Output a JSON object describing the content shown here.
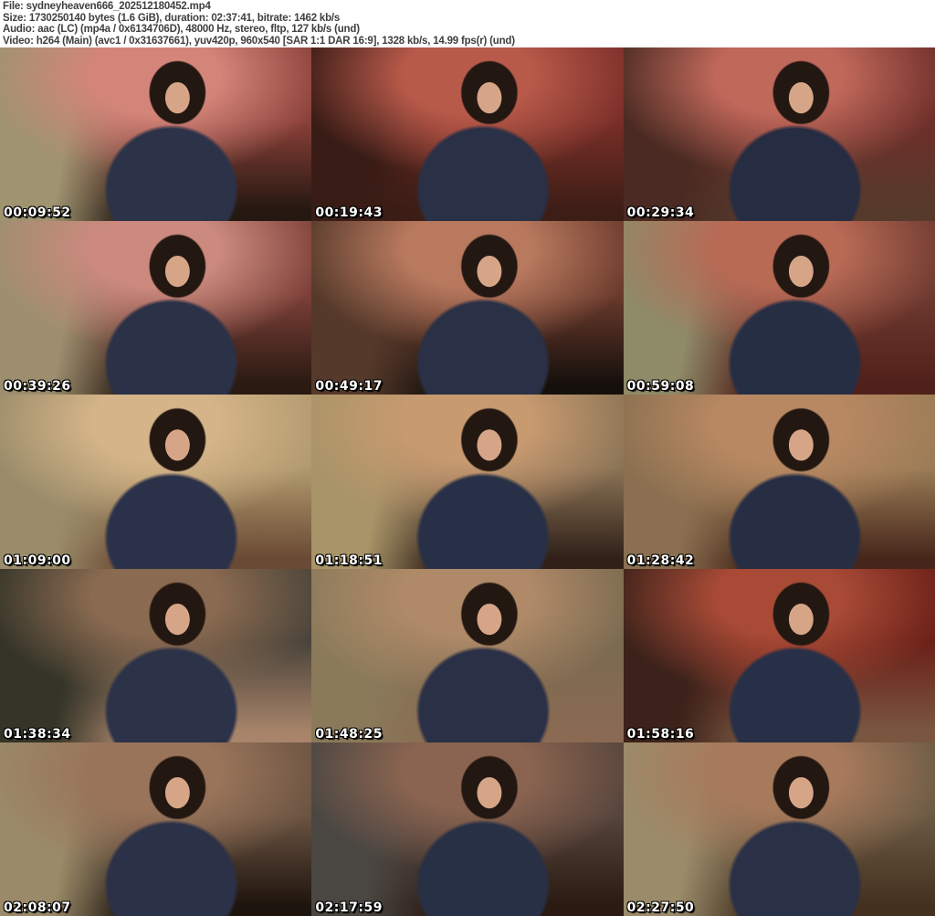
{
  "header": {
    "file_line": "File: sydneyheaven666_202512180452.mp4",
    "size_line": "Size: 1730250140 bytes (1.6 GiB), duration: 02:37:41, bitrate: 1462 kb/s",
    "audio_line": "Audio: aac (LC) (mp4a / 0x6134706D), 48000 Hz, stereo, fltp, 127 kb/s (und)",
    "video_line": "Video: h264 (Main) (avc1 / 0x31637661), yuv420p, 960x540 [SAR 1:1 DAR 16:9], 1328 kb/s, 14.99 fps(r) (und)"
  },
  "colors": {
    "header_bg": "#ffffff",
    "header_text": "#3f3f3f",
    "timestamp_text": "#ffffff",
    "timestamp_outline": "#000000",
    "skin": "#d6a588",
    "hair": "#231711"
  },
  "grid": {
    "columns": 3,
    "rows": 5
  },
  "thumbnails": [
    {
      "timestamp": "00:09:52",
      "palette": {
        "side": "#9f9370",
        "wall": "#8a4038",
        "glow": "#d4857a",
        "figure": "#2c3349",
        "floor": "#241811"
      }
    },
    {
      "timestamp": "00:19:43",
      "palette": {
        "side": "#3a1c16",
        "wall": "#7a2e28",
        "glow": "#b85a4a",
        "figure": "#2a3046",
        "floor": "#3c1e16"
      }
    },
    {
      "timestamp": "00:29:34",
      "palette": {
        "side": "#4a2a22",
        "wall": "#6e2f2a",
        "glow": "#c0685a",
        "figure": "#262c42",
        "floor": "#553a2c"
      }
    },
    {
      "timestamp": "00:39:26",
      "palette": {
        "side": "#9c8e6e",
        "wall": "#7c4038",
        "glow": "#cc8a7e",
        "figure": "#2b3147",
        "floor": "#2a1a12"
      }
    },
    {
      "timestamp": "00:49:17",
      "palette": {
        "side": "#55392a",
        "wall": "#6a3a2c",
        "glow": "#b8795e",
        "figure": "#2a3045",
        "floor": "#16100c"
      }
    },
    {
      "timestamp": "00:59:08",
      "palette": {
        "side": "#8f8a68",
        "wall": "#6e3a30",
        "glow": "#b86a55",
        "figure": "#262e44",
        "floor": "#50201a"
      }
    },
    {
      "timestamp": "01:09:00",
      "palette": {
        "side": "#9a8c6a",
        "wall": "#b19a6e",
        "glow": "#d4b488",
        "figure": "#2b3148",
        "floor": "#6a4a34"
      }
    },
    {
      "timestamp": "01:18:51",
      "palette": {
        "side": "#a89468",
        "wall": "#8a7456",
        "glow": "#c89a70",
        "figure": "#283047",
        "floor": "#302018"
      }
    },
    {
      "timestamp": "01:28:42",
      "palette": {
        "side": "#8a7050",
        "wall": "#9a7c56",
        "glow": "#b88862",
        "figure": "#272e44",
        "floor": "#46261a"
      }
    },
    {
      "timestamp": "01:38:34",
      "palette": {
        "side": "#343428",
        "wall": "#4a443a",
        "glow": "#8a6a50",
        "figure": "#2c3248",
        "floor": "#a8846a"
      }
    },
    {
      "timestamp": "01:48:25",
      "palette": {
        "side": "#8a7a5a",
        "wall": "#7a6a50",
        "glow": "#b08a68",
        "figure": "#2a3046",
        "floor": "#8a6a52"
      }
    },
    {
      "timestamp": "01:58:16",
      "palette": {
        "side": "#3c221a",
        "wall": "#6a2018",
        "glow": "#a84a36",
        "figure": "#283047",
        "floor": "#7a5640"
      }
    },
    {
      "timestamp": "02:08:07",
      "palette": {
        "side": "#9a8a68",
        "wall": "#6a5442",
        "glow": "#9a745a",
        "figure": "#2b3147",
        "floor": "#1e140e"
      }
    },
    {
      "timestamp": "02:17:59",
      "palette": {
        "side": "#4a4642",
        "wall": "#55443c",
        "glow": "#8a6450",
        "figure": "#283046",
        "floor": "#2a1a12"
      }
    },
    {
      "timestamp": "02:27:50",
      "palette": {
        "side": "#9a8c6a",
        "wall": "#6a5a44",
        "glow": "#a87a5c",
        "figure": "#2a3046",
        "floor": "#44301f"
      }
    }
  ]
}
